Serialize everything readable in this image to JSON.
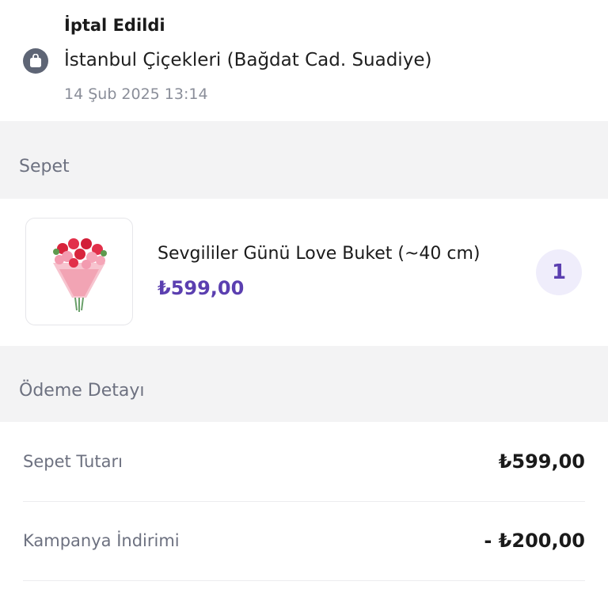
{
  "order": {
    "status": "İptal Edildi",
    "store_icon": "shopping-bag-icon",
    "store_name": "İstanbul Çiçekleri (Bağdat Cad. Suadiye)",
    "date": "14 Şub 2025 13:14"
  },
  "cart": {
    "title": "Sepet",
    "items": [
      {
        "image": "flower-bouquet-image",
        "name": "Sevgililer Günü Love Buket (~40 cm)",
        "price": "₺599,00",
        "quantity": "1"
      }
    ]
  },
  "payment": {
    "title": "Ödeme Detayı",
    "rows": [
      {
        "label": "Sepet Tutarı",
        "value": "₺599,00"
      },
      {
        "label": "Kampanya İndirimi",
        "value": "- ₺200,00"
      }
    ]
  },
  "colors": {
    "accent": "#5b3fb0",
    "accent_bg": "#efedfb",
    "section_bg": "#f3f3f4",
    "muted_text": "#6d7180"
  }
}
